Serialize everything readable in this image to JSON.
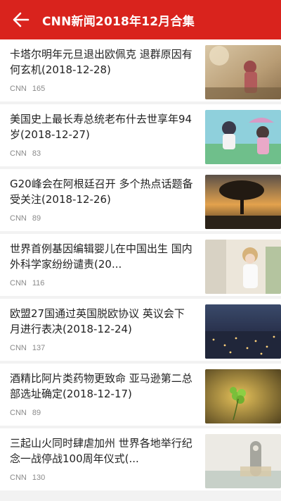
{
  "header": {
    "title": "CNN新闻2018年12月合集"
  },
  "articles": [
    {
      "title": "卡塔尔明年元旦退出欧佩克 退群原因有何玄机(2018-12-28)",
      "source": "CNN",
      "count": "165"
    },
    {
      "title": "美国史上最长寿总统老布什去世享年94岁(2018-12-27)",
      "source": "CNN",
      "count": "83"
    },
    {
      "title": "G20峰会在阿根廷召开 多个热点话题备受关注(2018-12-26)",
      "source": "CNN",
      "count": "89"
    },
    {
      "title": "世界首例基因编辑婴儿在中国出生 国内外科学家纷纷谴责(20...",
      "source": "CNN",
      "count": "116"
    },
    {
      "title": "欧盟27国通过英国脱欧协议 英议会下月进行表决(2018-12-24)",
      "source": "CNN",
      "count": "137"
    },
    {
      "title": "酒精比阿片类药物更致命 亚马逊第二总部选址确定(2018-12-17)",
      "source": "CNN",
      "count": "89"
    },
    {
      "title": "三起山火同时肆虐加州 世界各地举行纪念一战停战100周年仪式(...",
      "source": "CNN",
      "count": "130"
    }
  ]
}
